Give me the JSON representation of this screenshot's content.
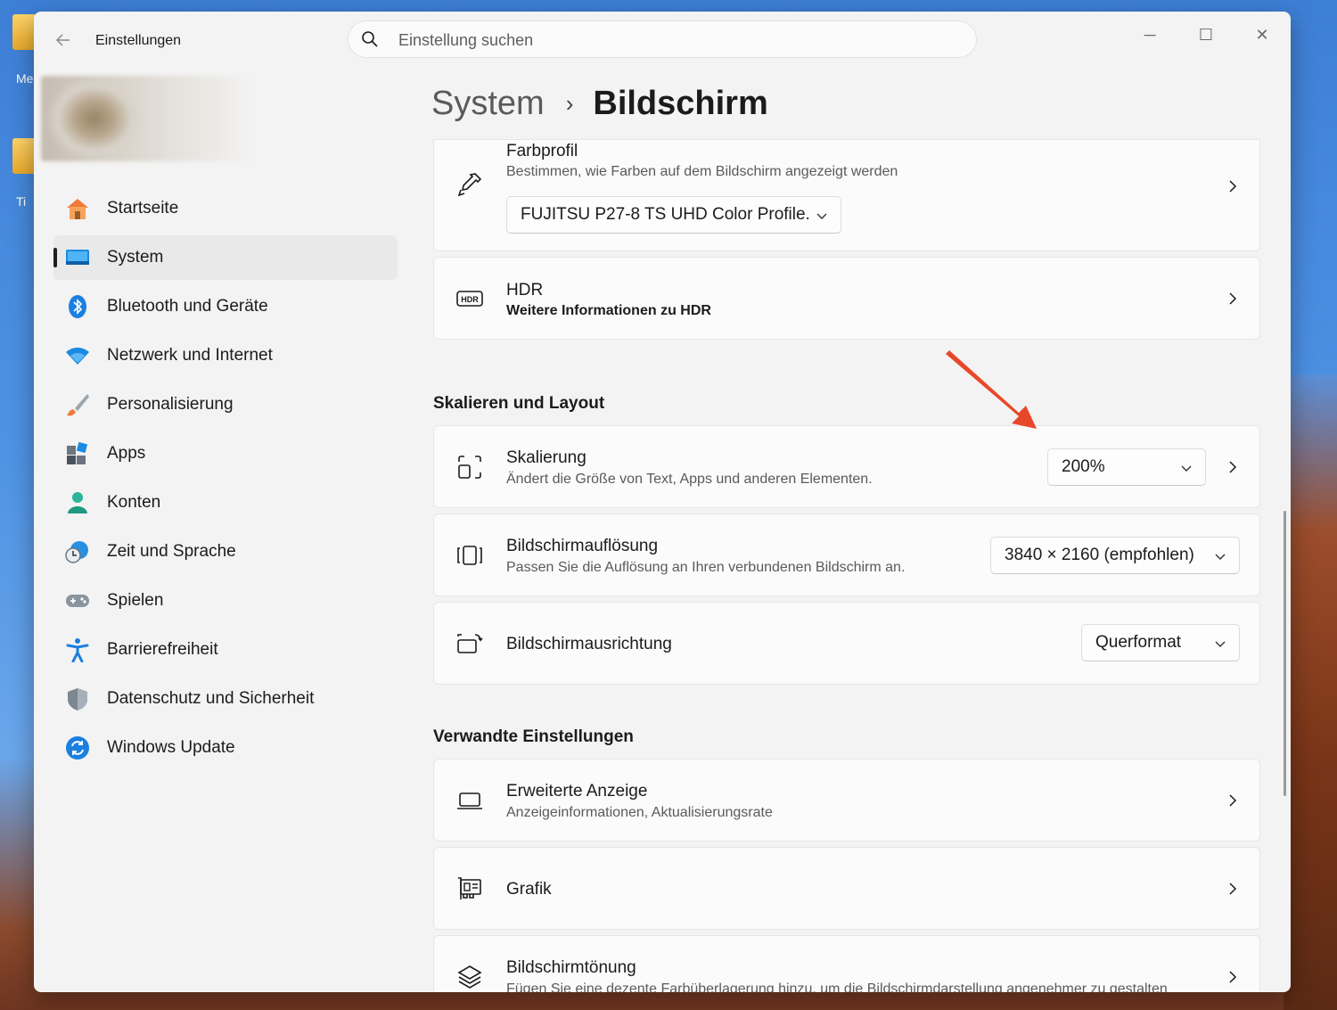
{
  "desktop": {
    "icon_labels": [
      "Me",
      "Ti"
    ]
  },
  "window": {
    "app_title": "Einstellungen",
    "search": {
      "placeholder": "Einstellung suchen"
    },
    "controls": {
      "minimize": "─",
      "maximize": "☐",
      "close": "✕"
    }
  },
  "sidebar": {
    "items": [
      {
        "label": "Startseite",
        "icon": "home-icon"
      },
      {
        "label": "System",
        "icon": "system-display-icon",
        "active": true
      },
      {
        "label": "Bluetooth und Geräte",
        "icon": "bluetooth-icon"
      },
      {
        "label": "Netzwerk und Internet",
        "icon": "wifi-icon"
      },
      {
        "label": "Personalisierung",
        "icon": "paintbrush-icon"
      },
      {
        "label": "Apps",
        "icon": "apps-icon"
      },
      {
        "label": "Konten",
        "icon": "account-icon"
      },
      {
        "label": "Zeit und Sprache",
        "icon": "globe-clock-icon"
      },
      {
        "label": "Spielen",
        "icon": "gamepad-icon"
      },
      {
        "label": "Barrierefreiheit",
        "icon": "accessibility-icon"
      },
      {
        "label": "Datenschutz und Sicherheit",
        "icon": "shield-icon"
      },
      {
        "label": "Windows Update",
        "icon": "update-icon"
      }
    ]
  },
  "breadcrumb": {
    "parent": "System",
    "separator": "›",
    "current": "Bildschirm"
  },
  "cards": {
    "farbprofil": {
      "title": "Farbprofil",
      "subtitle": "Bestimmen, wie Farben auf dem Bildschirm angezeigt werden",
      "dropdown": "FUJITSU P27-8 TS UHD Color Profile."
    },
    "hdr": {
      "title": "HDR",
      "link": "Weitere Informationen zu HDR",
      "icon_text": "HDR"
    },
    "section_scale": "Skalieren und Layout",
    "skalierung": {
      "title": "Skalierung",
      "subtitle": "Ändert die Größe von Text, Apps und anderen Elementen.",
      "dropdown": "200%"
    },
    "aufloesung": {
      "title": "Bildschirmauflösung",
      "subtitle": "Passen Sie die Auflösung an Ihren verbundenen Bildschirm an.",
      "dropdown": "3840 × 2160 (empfohlen)"
    },
    "ausrichtung": {
      "title": "Bildschirmausrichtung",
      "dropdown": "Querformat"
    },
    "section_related": "Verwandte Einstellungen",
    "erweitert": {
      "title": "Erweiterte Anzeige",
      "subtitle": "Anzeigeinformationen, Aktualisierungsrate"
    },
    "grafik": {
      "title": "Grafik"
    },
    "toenung": {
      "title": "Bildschirmtönung",
      "subtitle": "Fügen Sie eine dezente Farbüberlagerung hinzu, um die Bildschirmdarstellung angenehmer zu gestalten"
    }
  },
  "annotation": {
    "arrow_color": "#e8482a"
  },
  "colors": {
    "accent": "#0067c0",
    "window_bg": "#f3f3f3",
    "card_bg": "#fbfbfb"
  }
}
